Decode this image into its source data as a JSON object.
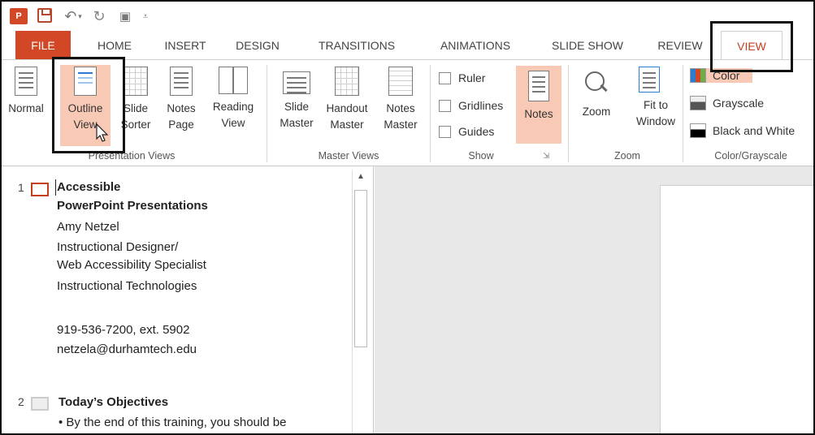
{
  "quick_access": {
    "app_logo": "P",
    "undo_icon": "undo-icon",
    "redo_icon": "redo-icon",
    "present_icon": "present-from-beginning-icon",
    "customize_icon": "customize-quick-access-icon"
  },
  "tabs": [
    {
      "label": "FILE"
    },
    {
      "label": "HOME"
    },
    {
      "label": "INSERT"
    },
    {
      "label": "DESIGN"
    },
    {
      "label": "TRANSITIONS"
    },
    {
      "label": "ANIMATIONS"
    },
    {
      "label": "SLIDE SHOW"
    },
    {
      "label": "REVIEW"
    },
    {
      "label": "VIEW",
      "active": true
    }
  ],
  "ribbon": {
    "presentation_views": {
      "group_label": "Presentation Views",
      "normal": "Normal",
      "outline_view_1": "Outline",
      "outline_view_2": "View",
      "slide_sorter_1": "Slide",
      "slide_sorter_2": "Sorter",
      "notes_page_1": "Notes",
      "notes_page_2": "Page",
      "reading_view_1": "Reading",
      "reading_view_2": "View"
    },
    "master_views": {
      "group_label": "Master Views",
      "slide_master_1": "Slide",
      "slide_master_2": "Master",
      "handout_master_1": "Handout",
      "handout_master_2": "Master",
      "notes_master_1": "Notes",
      "notes_master_2": "Master"
    },
    "show": {
      "group_label": "Show",
      "ruler": "Ruler",
      "gridlines": "Gridlines",
      "guides": "Guides",
      "notes": "Notes"
    },
    "zoom": {
      "group_label": "Zoom",
      "zoom": "Zoom",
      "fit_to_window_1": "Fit to",
      "fit_to_window_2": "Window"
    },
    "color_grayscale": {
      "group_label": "Color/Grayscale",
      "color": "Color",
      "grayscale": "Grayscale",
      "black_and_white": "Black and White"
    }
  },
  "outline": {
    "slide1": {
      "number": "1",
      "title_line1": "Accessible",
      "title_line2": "PowerPoint Presentations",
      "lines": [
        "Amy Netzel",
        "Instructional Designer/",
        "Web Accessibility Specialist",
        "Instructional Technologies",
        "",
        "919-536-7200, ext. 5902",
        "netzela@durhamtech.edu"
      ]
    },
    "slide2": {
      "number": "2",
      "title": "Today’s Objectives",
      "bullet": "• By the end of this training, you should be"
    }
  },
  "colors": {
    "accent": "#d24726",
    "active_tab_text": "#c43e1c",
    "highlight_fill": "#f8c9b5"
  }
}
